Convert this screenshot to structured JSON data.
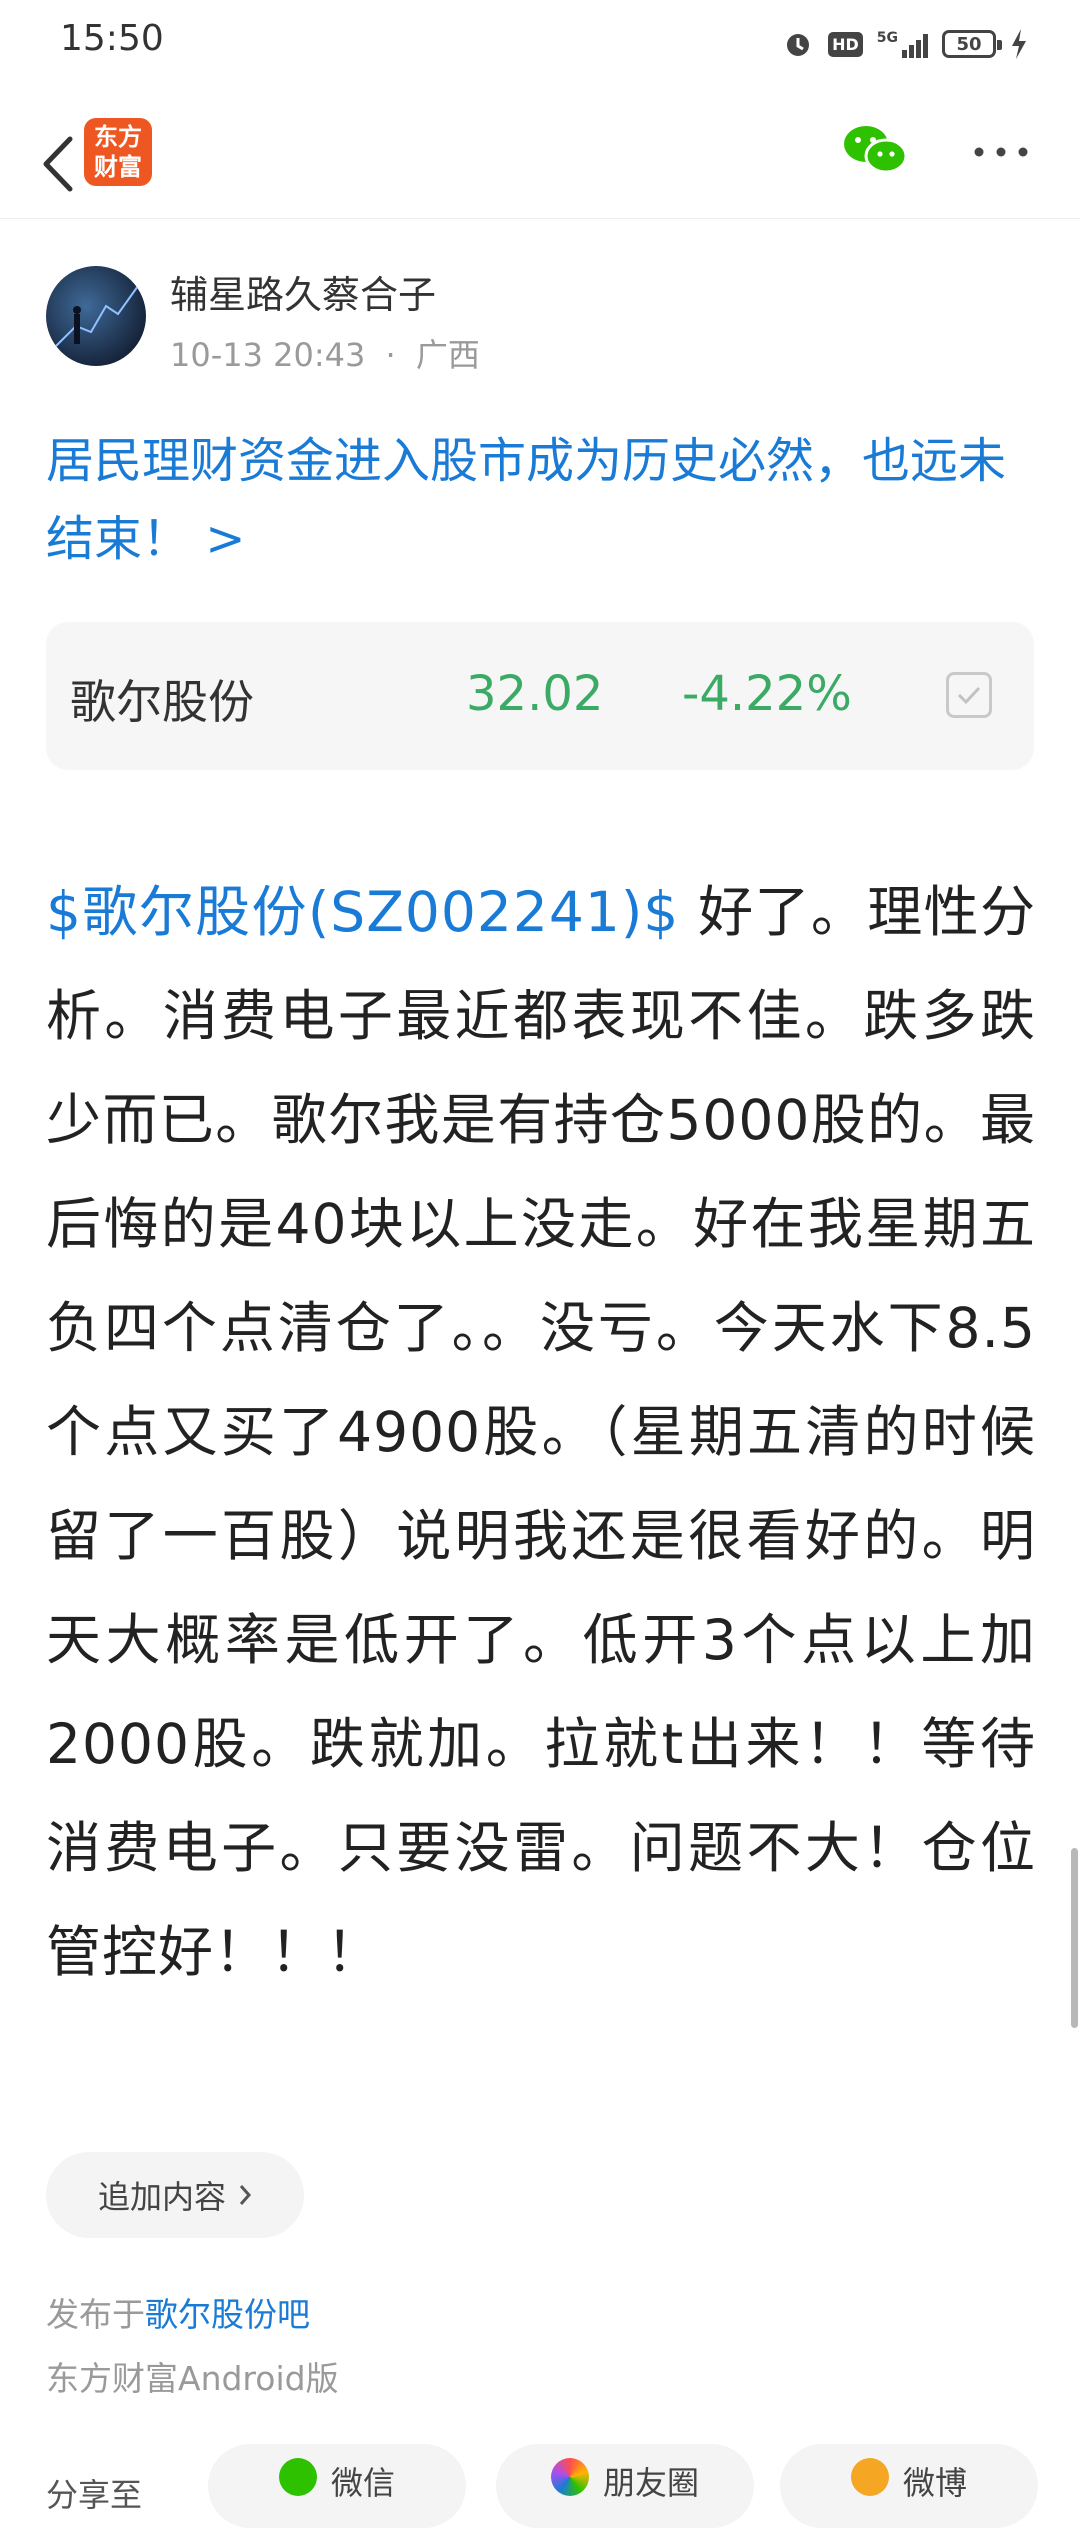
{
  "status_bar": {
    "time": "15:50",
    "hd_badge": "HD",
    "network": "5G",
    "battery": "50"
  },
  "nav": {
    "logo_line1": "东方",
    "logo_line2": "财富"
  },
  "author": {
    "name": "辅星路久蔡合子",
    "date": "10-13 20:43",
    "separator": "·",
    "location": "广西"
  },
  "post": {
    "title": "居民理财资金进入股市成为历史必然，也远未结束！ >",
    "stock_link": "$歌尔股份(SZ002241)$",
    "body": "  好了。理性分析。消费电子最近都表现不佳。跌多跌少而已。歌尔我是有持仓5000股的。最后悔的是40块以上没走。好在我星期五负四个点清仓了。。没亏。今天水下8.5个点又买了4900股。（星期五清的时候留了一百股）说明我还是很看好的。明天大概率是低开了。低开3个点以上加2000股。跌就加。拉就t出来！！等待消费电子。只要没雷。问题不大！仓位管控好！！！"
  },
  "stock_card": {
    "name": "歌尔股份",
    "price": "32.02",
    "change": "-4.22%",
    "change_color": "#3aaa64"
  },
  "add_content": {
    "label": "追加内容"
  },
  "footer": {
    "published_prefix": "发布于",
    "forum": "歌尔股份吧",
    "client": "东方财富Android版"
  },
  "share": {
    "label": "分享至",
    "targets": [
      "微信",
      "朋友圈",
      "微博"
    ]
  },
  "colors": {
    "link": "#1a7bd6",
    "brand": "#ee5722"
  }
}
